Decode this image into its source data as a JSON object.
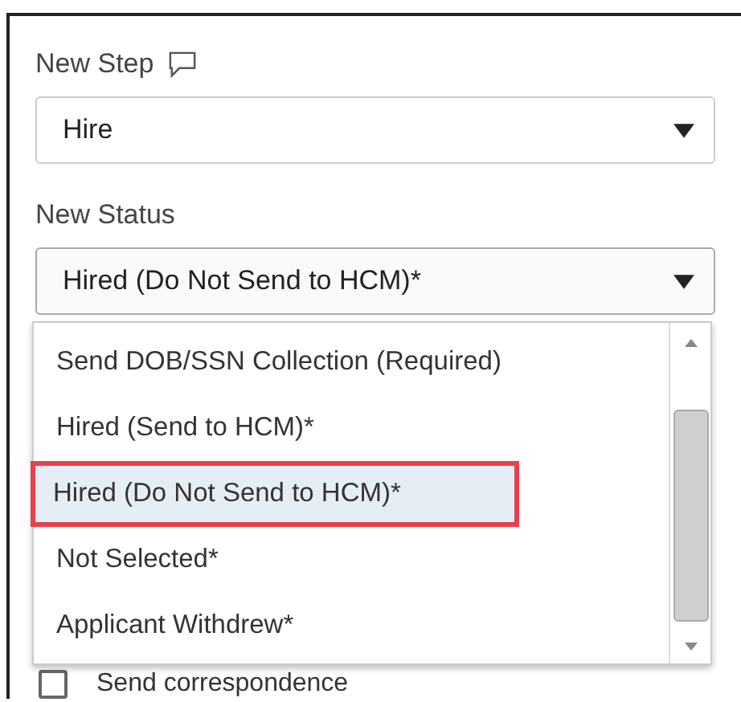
{
  "step_field": {
    "label": "New Step",
    "value": "Hire"
  },
  "status_field": {
    "label": "New Status",
    "value": "Hired (Do Not Send to HCM)*",
    "expanded": true
  },
  "status_options": [
    {
      "label": "Send DOB/SSN Collection (Required)",
      "selected": false,
      "outlined": false
    },
    {
      "label": "Hired (Send to HCM)*",
      "selected": false,
      "outlined": false
    },
    {
      "label": "Hired (Do Not Send to HCM)*",
      "selected": true,
      "outlined": true
    },
    {
      "label": "Not Selected*",
      "selected": false,
      "outlined": false
    },
    {
      "label": "Applicant Withdrew*",
      "selected": false,
      "outlined": false
    }
  ],
  "correspondence": {
    "label": "Send correspondence",
    "checked": false
  }
}
